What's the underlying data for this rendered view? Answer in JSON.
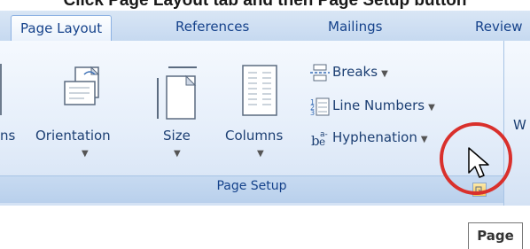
{
  "caption": "Click Page Layout tab and then Page Setup button",
  "tabs": [
    {
      "label": "Page Layout",
      "active": true
    },
    {
      "label": "References"
    },
    {
      "label": "Mailings"
    },
    {
      "label": "Review"
    }
  ],
  "page_setup_group": {
    "label": "Page Setup",
    "partial_button": "ns",
    "orientation": "Orientation",
    "size": "Size",
    "columns": "Columns",
    "breaks": "Breaks",
    "line_numbers": "Line Numbers",
    "hyphenation": "Hyphenation",
    "dialog_launcher_icon": "dialog-launcher-icon"
  },
  "next_group_partial": "W",
  "tooltip": "Page",
  "colors": {
    "highlight": "#d9302c",
    "tab_text": "#15428b",
    "ribbon_bg": "#e5eefa"
  }
}
